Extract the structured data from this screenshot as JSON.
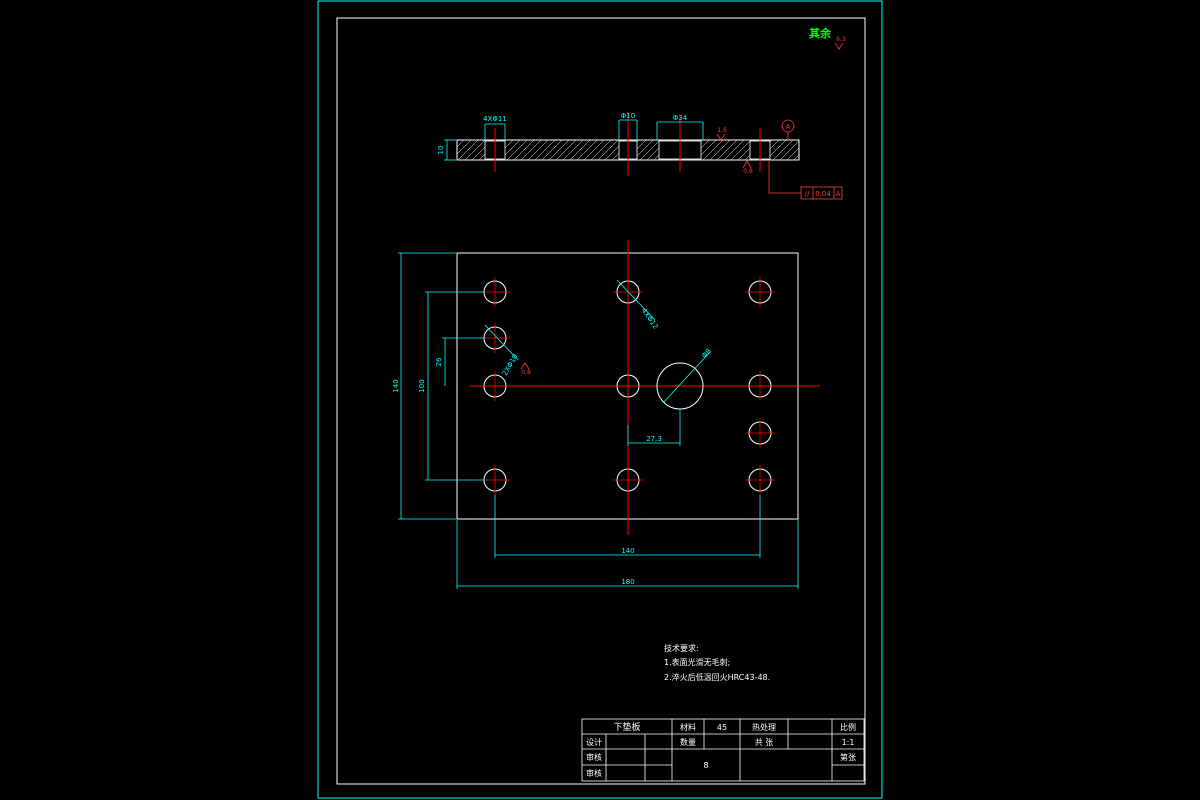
{
  "colors": {
    "background": "#000000",
    "frame": "#00ffff",
    "part": "#ffffff",
    "centerline": "#ff0000",
    "dimension": "#00ffff",
    "note": "#ffffff",
    "roughness": "#ff3b3b",
    "corner_mark": "#00ff00"
  },
  "corner_note": {
    "text": "其余",
    "roughness": "6.3"
  },
  "section_view": {
    "thickness": "10",
    "dims": [
      "4ΧΦ11",
      "Φ10",
      "Φ34"
    ],
    "roughness_top": "1.6",
    "roughness_bottom": "0.8",
    "datum": "A",
    "tolerance": {
      "symbol": "//",
      "value": "0.04",
      "datum": "A"
    }
  },
  "plan_view": {
    "dims": {
      "height_total": "140",
      "height_holes": "100",
      "height_small": "26",
      "width_holes": "140",
      "width_total": "180",
      "offset_big": "27.3",
      "hole_pin": "2ΧΦ10",
      "hole_corner": "4ΧΦ12",
      "hole_big": "Φ8",
      "roughness_pin": "0.8"
    }
  },
  "tech_notes": {
    "title": "技术要求:",
    "items": [
      "1.表面光滑无毛刺;",
      "2.淬火后低温回火HRC43-48."
    ]
  },
  "title_block": {
    "part_name": "下垫板",
    "material_label": "材料",
    "material": "45",
    "heat_label": "热处理",
    "scale_label": "比例",
    "scale": "1:1",
    "design_label": "设计",
    "process_label": "数量",
    "total_label": "共 张",
    "check_label": "审核",
    "drawing_no": "8",
    "review_label": "审核",
    "sheet_label": "第张"
  }
}
